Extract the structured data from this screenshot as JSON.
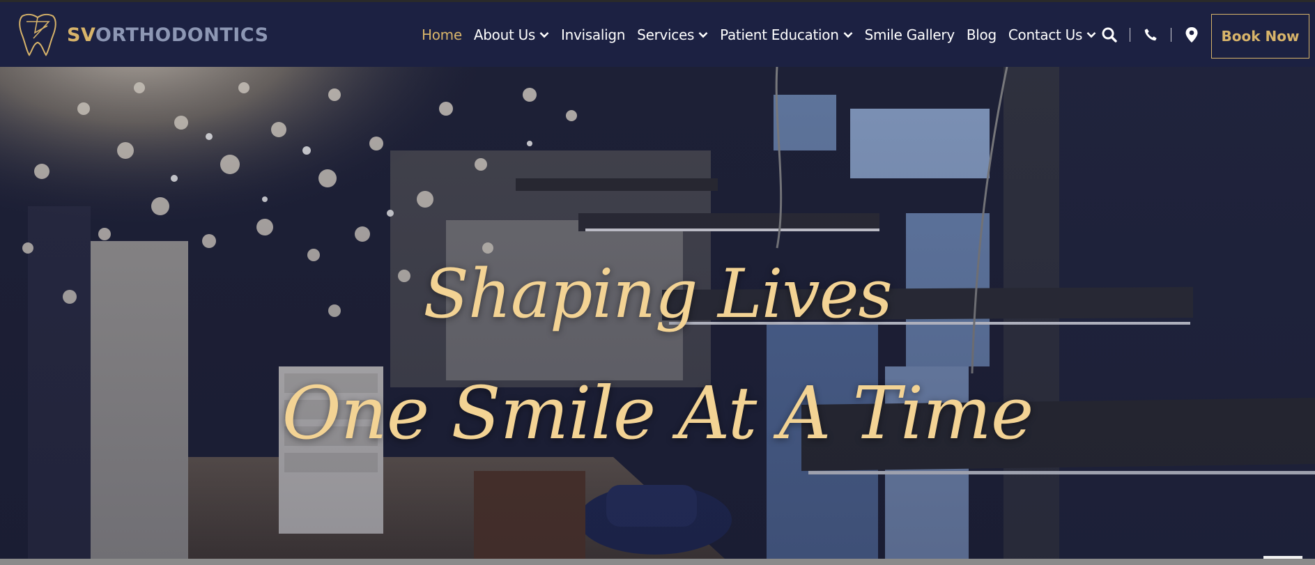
{
  "brand": {
    "sv": "SV",
    "rest": "ORTHODONTICS"
  },
  "nav": {
    "items": [
      {
        "label": "Home",
        "active": true,
        "dropdown": false
      },
      {
        "label": "About Us",
        "active": false,
        "dropdown": true
      },
      {
        "label": "Invisalign",
        "active": false,
        "dropdown": false
      },
      {
        "label": "Services",
        "active": false,
        "dropdown": true
      },
      {
        "label": "Patient Education",
        "active": false,
        "dropdown": true
      },
      {
        "label": "Smile Gallery",
        "active": false,
        "dropdown": false
      },
      {
        "label": "Blog",
        "active": false,
        "dropdown": false
      },
      {
        "label": "Contact Us",
        "active": false,
        "dropdown": true
      }
    ]
  },
  "tools": {
    "search_icon": "search-icon",
    "phone_icon": "phone-icon",
    "location_icon": "map-pin-icon"
  },
  "cta": {
    "book_label": "Book Now"
  },
  "hero": {
    "line1": "Shaping Lives",
    "line2": "One Smile At A Time"
  },
  "colors": {
    "navy": "#1c2142",
    "gold": "#d8b46a",
    "headline": "#f3d394",
    "logo_gray": "#8d97b4"
  }
}
